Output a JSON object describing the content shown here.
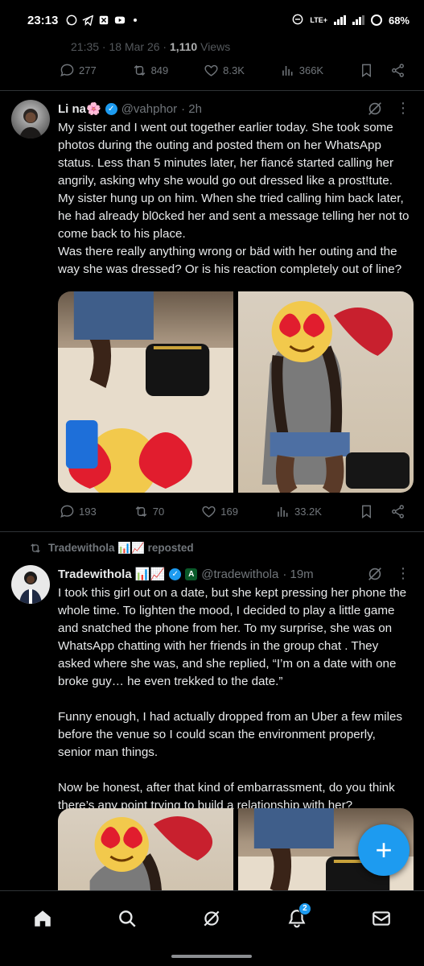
{
  "status_bar": {
    "time": "23:13",
    "icons": [
      "whatsapp-icon",
      "telegram-icon",
      "app-icon",
      "youtube-icon"
    ],
    "network": "LTE+",
    "battery": "68%"
  },
  "previous_tweet": {
    "meta_time": "21:35 · 18 Mar 26 · ",
    "views_count": "1,110",
    "views_label": " Views",
    "replies": "277",
    "reposts": "849",
    "likes": "8.3K",
    "views": "366K"
  },
  "tweet1": {
    "name": "Li na🌸",
    "handle": "@vahphor",
    "time": "· 2h",
    "text_p1": "My sister and I went out together earlier today. She took some photos during the outing and posted them on her WhatsApp status. Less than 5 minutes later, her fiancé started calling her angrily, asking why she would go out dressed like a prost!tute. My sister hung up on him. When she tried calling him back later, he had already bl0cked her and sent a message telling her not to come back to his place.",
    "text_p2": "Was there really anything wrong or bäd with her outing and the way she was dressed? Or is his reaction completely out of line?",
    "replies": "193",
    "reposts": "70",
    "likes": "169",
    "views": "33.2K"
  },
  "repost_banner": {
    "label": "Tradewithola 📊📈 reposted"
  },
  "tweet2": {
    "name": "Tradewithola 📊📈",
    "handle": "@tradewithola",
    "time": "· 19m",
    "text_p1": "I took this girl out on a date, but she kept pressing her phone the whole time. To lighten the mood, I decided to play a little game and snatched the phone from her. To my surprise, she was on WhatsApp chatting with her friends in the group chat . They asked where she was, and she replied, “I’m on a date with one broke guy… he even trekked to the date.”",
    "text_p2": "Funny enough, I had actually dropped from an Uber a few miles before the venue so I could scan the environment properly, senior man things.",
    "text_p3": "Now be honest, after that kind of embarrassment, do you think there’s any point trying to build a relationship with her?"
  },
  "fab": {
    "label": "+"
  },
  "bottom_nav": {
    "items": [
      "home-icon",
      "search-icon",
      "grok-icon",
      "notifications-icon",
      "messages-icon"
    ],
    "notif_count": "2"
  },
  "colors": {
    "accent": "#1d9bf0",
    "muted": "#71767b",
    "text": "#e7e9ea",
    "bg": "#000000"
  }
}
